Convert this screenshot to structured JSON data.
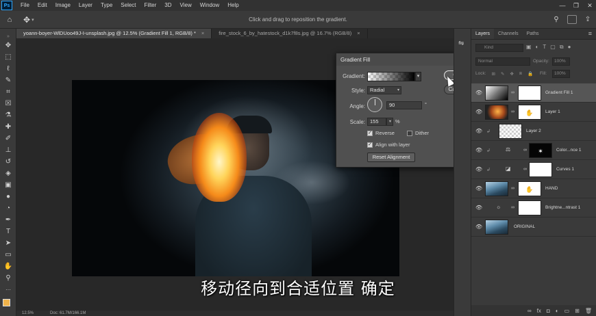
{
  "menubar": {
    "logo": "Ps",
    "items": [
      "File",
      "Edit",
      "Image",
      "Layer",
      "Type",
      "Select",
      "Filter",
      "3D",
      "View",
      "Window",
      "Help"
    ],
    "window_controls": [
      "—",
      "❐",
      "✕"
    ]
  },
  "optionsbar": {
    "hint": "Click and drag to reposition the gradient.",
    "icons": [
      "search-icon",
      "workspace-icon",
      "share-icon"
    ]
  },
  "doc_tabs": [
    {
      "label": "yoann-boyer-WlDUoo49J-I-unsplash.jpg @ 12.5% (Gradient Fill 1, RGB/8) *",
      "close": "×"
    },
    {
      "label": "fire_stock_6_by_hatestock_d1k7f8s.jpg @ 16.7% (RGB/8)",
      "close": "×"
    }
  ],
  "caption": "移动径向到合适位置  确定",
  "statusbar": {
    "zoom": "12.5%",
    "doc": "Doc: 61.7M/166.1M"
  },
  "dialog": {
    "title": "Gradient Fill",
    "close": "✕",
    "gradient_label": "Gradient:",
    "style_label": "Style:",
    "style_value": "Radial",
    "angle_label": "Angle:",
    "angle_value": "90",
    "angle_unit": "°",
    "scale_label": "Scale:",
    "scale_value": "155",
    "scale_unit": "%",
    "reverse_label": "Reverse",
    "reverse_checked": true,
    "dither_label": "Dither",
    "dither_checked": false,
    "align_label": "Align with layer",
    "align_checked": true,
    "reset_label": "Reset Alignment",
    "ok_label": "OK",
    "cancel_label": "Cancel"
  },
  "layers_panel": {
    "tabs": [
      "Layers",
      "Channels",
      "Paths"
    ],
    "active_tab": "Layers",
    "menu_icon": "≡",
    "filter_placeholder": "Kind",
    "blend_mode": "Normal",
    "opacity_label": "Opacity:",
    "opacity_value": "100%",
    "lock_label": "Lock:",
    "fill_label": "Fill:",
    "fill_value": "100%",
    "layers": [
      {
        "name": "Gradient Fill 1",
        "selected": true,
        "thumb": "gradient",
        "mask": true
      },
      {
        "name": "Layer 1",
        "selected": false,
        "thumb": "fire",
        "mask": true
      },
      {
        "name": "Layer 2",
        "selected": false,
        "thumb": "checker",
        "mask": false
      },
      {
        "name": "Color...nce 1",
        "selected": false,
        "thumb": "adj-balance",
        "mask": true
      },
      {
        "name": "Curves 1",
        "selected": false,
        "thumb": "adj-curves",
        "mask": true
      },
      {
        "name": "HAND",
        "selected": false,
        "thumb": "mountain",
        "mask": true
      },
      {
        "name": "Brightne...ntrast 1",
        "selected": false,
        "thumb": "adj-brightness",
        "mask": true
      },
      {
        "name": "ORIGINAL",
        "selected": false,
        "thumb": "mountain",
        "mask": false
      }
    ],
    "bottom_icons": [
      "link-icon",
      "fx-icon",
      "mask-icon",
      "adjustment-icon",
      "group-icon",
      "new-layer-icon",
      "trash-icon"
    ]
  },
  "colors": {
    "foreground": "#f0b34a",
    "background": "#ffffff",
    "accent": "#31a8ff"
  }
}
